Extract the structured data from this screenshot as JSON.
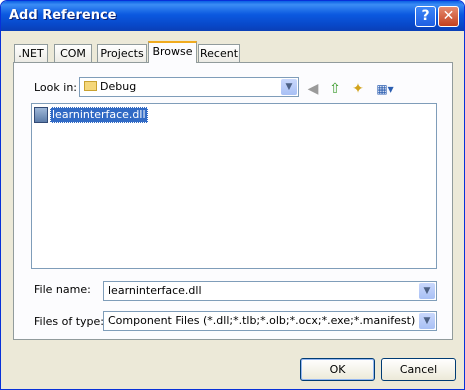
{
  "window": {
    "title": "Add Reference"
  },
  "titlebar": {
    "help_glyph": "?",
    "close_glyph": "✕"
  },
  "tabs": [
    {
      "label": ".NET"
    },
    {
      "label": "COM"
    },
    {
      "label": "Projects"
    },
    {
      "label": "Browse",
      "active": true
    },
    {
      "label": "Recent"
    }
  ],
  "lookin": {
    "label": "Look in:",
    "value": "Debug"
  },
  "toolbar": {
    "back_glyph": "◀",
    "up_glyph": "⇧",
    "newfolder_glyph": "✦",
    "views_glyph": "▦▾"
  },
  "files": [
    {
      "name": "learninterface.dll",
      "selected": true
    }
  ],
  "filename": {
    "label": "File name:",
    "value": "learninterface.dll"
  },
  "filetype": {
    "label": "Files of type:",
    "value": "Component Files (*.dll;*.tlb;*.olb;*.ocx;*.exe;*.manifest)"
  },
  "buttons": {
    "ok": "OK",
    "cancel": "Cancel"
  },
  "colors": {
    "titlebar": "#0848c9",
    "selection": "#316ac5",
    "dialog_bg": "#ece9d8"
  }
}
